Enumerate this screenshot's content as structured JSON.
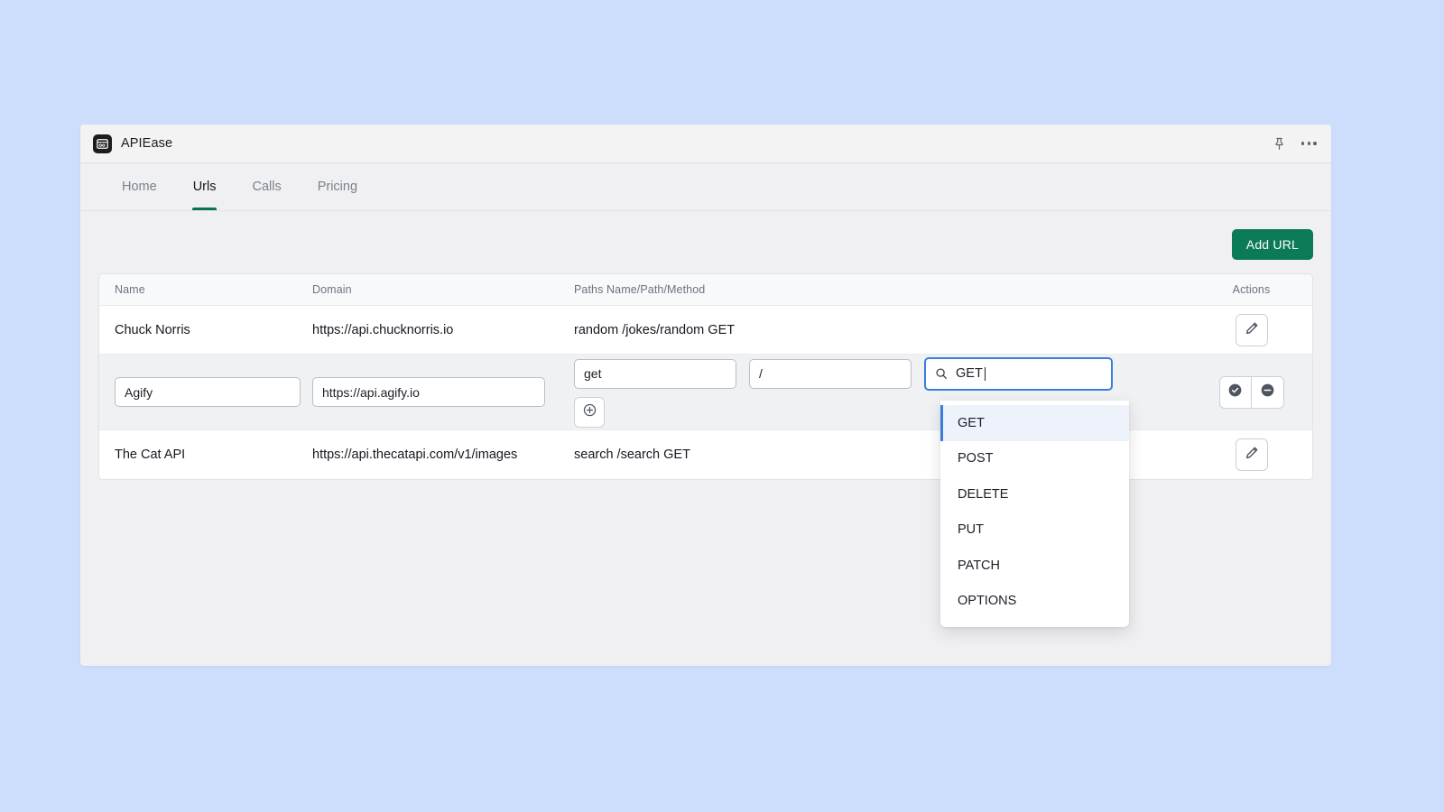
{
  "window": {
    "app_title": "APIEase",
    "logo_icon": "browser-window-icon",
    "pin_icon": "pin-icon",
    "more_icon": "more-options-icon"
  },
  "tabs": [
    {
      "label": "Home",
      "active": false
    },
    {
      "label": "Urls",
      "active": true
    },
    {
      "label": "Calls",
      "active": false
    },
    {
      "label": "Pricing",
      "active": false
    }
  ],
  "toolbar": {
    "add_url_label": "Add URL",
    "accent_color": "#0b7a57"
  },
  "table": {
    "headers": {
      "name": "Name",
      "domain": "Domain",
      "paths": "Paths Name/Path/Method",
      "actions": "Actions"
    },
    "rows": [
      {
        "mode": "view",
        "name": "Chuck Norris",
        "domain": "https://api.chucknorris.io",
        "paths": "random /jokes/random GET",
        "edit_icon": "pencil-icon"
      },
      {
        "mode": "edit",
        "name_value": "Agify",
        "domain_value": "https://api.agify.io",
        "path_name_value": "get",
        "path_path_value": "/",
        "method_value": "GET",
        "add_path_icon": "plus-circle-icon",
        "confirm_icon": "check-circle-icon",
        "cancel_icon": "minus-circle-icon"
      },
      {
        "mode": "view",
        "name": "The Cat API",
        "domain": "https://api.thecatapi.com/v1/images",
        "paths": "search /search GET",
        "edit_icon": "pencil-icon"
      }
    ]
  },
  "method_dropdown": {
    "search_icon": "search-icon",
    "query": "GET",
    "selected": "GET",
    "highlight_color": "#3b7ddd",
    "options": [
      "GET",
      "POST",
      "DELETE",
      "PUT",
      "PATCH",
      "OPTIONS"
    ]
  }
}
